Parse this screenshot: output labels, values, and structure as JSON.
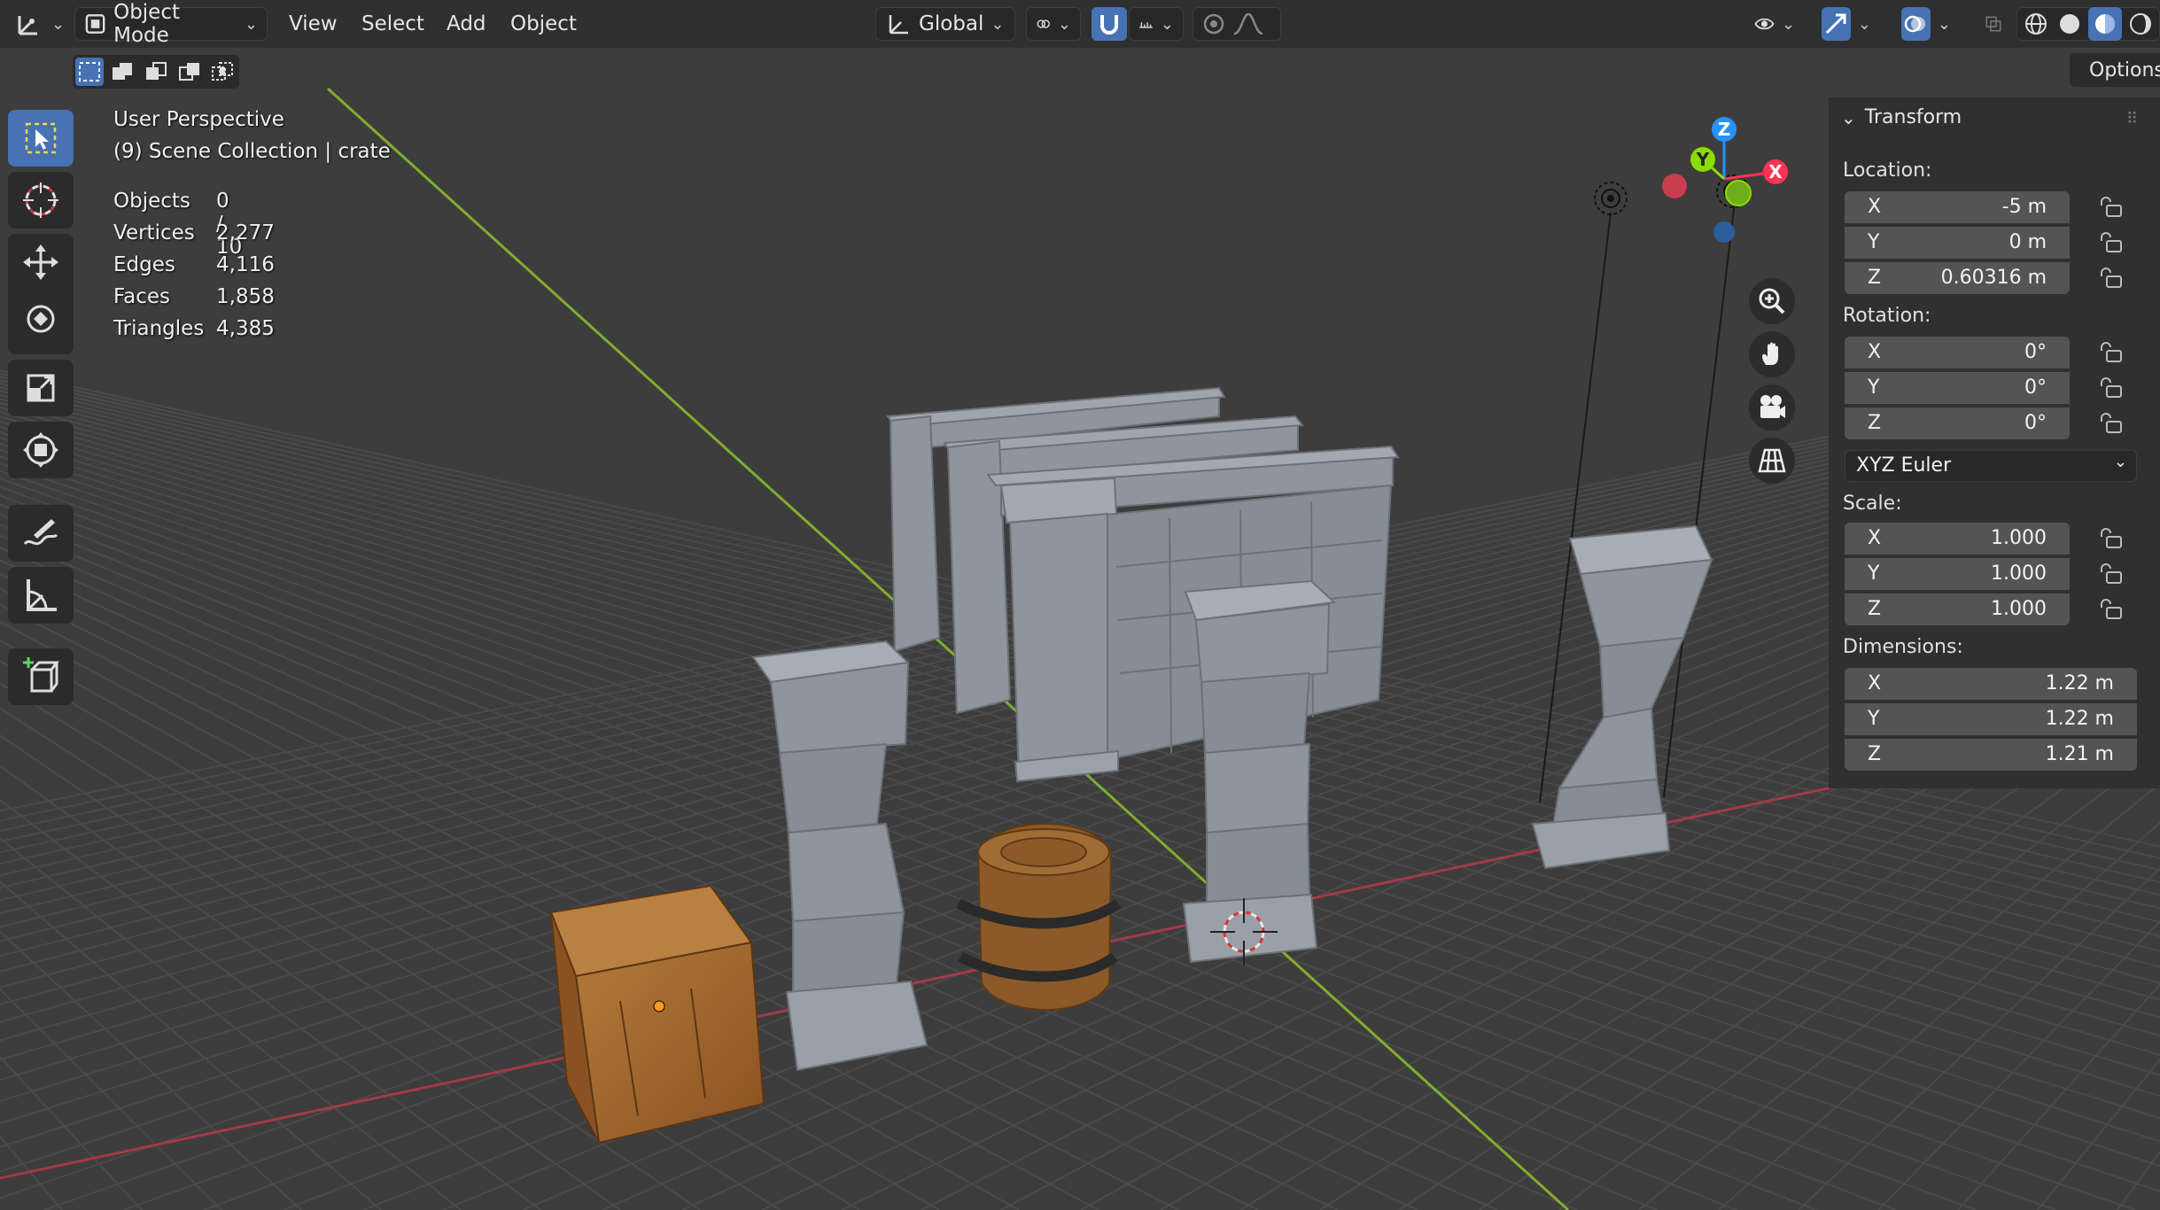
{
  "header": {
    "mode_label": "Object Mode",
    "menus": [
      "View",
      "Select",
      "Add",
      "Object"
    ],
    "orientation_label": "Global",
    "options_label": "Options"
  },
  "overlay": {
    "view_name": "User Perspective",
    "collection": "(9) Scene Collection | crate",
    "stats": [
      {
        "label": "Objects",
        "value": "0 / 10"
      },
      {
        "label": "Vertices",
        "value": "2,277"
      },
      {
        "label": "Edges",
        "value": "4,116"
      },
      {
        "label": "Faces",
        "value": "1,858"
      },
      {
        "label": "Triangles",
        "value": "4,385"
      }
    ]
  },
  "gizmo": {
    "x": "X",
    "y": "Y",
    "z": "Z"
  },
  "transform_panel": {
    "title": "Transform",
    "location_label": "Location:",
    "location": [
      {
        "axis": "X",
        "value": "-5 m"
      },
      {
        "axis": "Y",
        "value": "0 m"
      },
      {
        "axis": "Z",
        "value": "0.60316 m"
      }
    ],
    "rotation_label": "Rotation:",
    "rotation": [
      {
        "axis": "X",
        "value": "0°"
      },
      {
        "axis": "Y",
        "value": "0°"
      },
      {
        "axis": "Z",
        "value": "0°"
      }
    ],
    "rotation_mode": "XYZ Euler",
    "scale_label": "Scale:",
    "scale": [
      {
        "axis": "X",
        "value": "1.000"
      },
      {
        "axis": "Y",
        "value": "1.000"
      },
      {
        "axis": "Z",
        "value": "1.000"
      }
    ],
    "dimensions_label": "Dimensions:",
    "dimensions": [
      {
        "axis": "X",
        "value": "1.22 m"
      },
      {
        "axis": "Y",
        "value": "1.22 m"
      },
      {
        "axis": "Z",
        "value": "1.21 m"
      }
    ]
  },
  "colors": {
    "accent": "#4772b3",
    "x_axis": "#ff3352",
    "y_axis": "#8bdc00",
    "z_axis": "#2890ff",
    "crate": "#9a5f28",
    "stone": "#8f959d"
  },
  "icons": {
    "editor_type": "orientation-axes-icon",
    "tools": [
      "select-box-icon",
      "cursor-icon",
      "move-icon",
      "rotate-icon",
      "scale-icon",
      "transform-icon",
      "annotate-icon",
      "measure-icon",
      "add-cube-icon"
    ],
    "nav": [
      "zoom-icon",
      "pan-hand-icon",
      "camera-icon",
      "ortho-grid-icon"
    ]
  }
}
